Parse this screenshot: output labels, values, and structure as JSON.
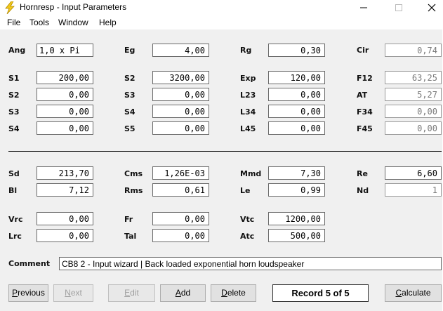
{
  "window": {
    "title": "Hornresp - Input Parameters"
  },
  "menu": [
    "File",
    "Tools",
    "Window",
    "Help"
  ],
  "icons": {
    "app": "lightning-bolt-icon",
    "minimize": "minimize-icon",
    "maximize": "maximize-icon",
    "close": "close-icon"
  },
  "fields": {
    "Ang": "1,0 x Pi",
    "Eg": "4,00",
    "Rg": "0,30",
    "Cir": "0,74",
    "S1": "200,00",
    "S2": "3200,00",
    "Exp": "120,00",
    "F12": "63,25",
    "S2b": "0,00",
    "S3": "0,00",
    "L23": "0,00",
    "AT": "5,27",
    "S3b": "0,00",
    "S4": "0,00",
    "L34": "0,00",
    "F34": "0,00",
    "S4b": "0,00",
    "S5": "0,00",
    "L45": "0,00",
    "F45": "0,00",
    "Sd": "213,70",
    "Cms": "1,26E-03",
    "Mmd": "7,30",
    "Re": "6,60",
    "Bl": "7,12",
    "Rms": "0,61",
    "Le": "0,99",
    "Nd": "1",
    "Vrc": "0,00",
    "Fr": "0,00",
    "Vtc": "1200,00",
    "Lrc": "0,00",
    "Tal": "0,00",
    "Atc": "500,00"
  },
  "labels": {
    "Ang": "Ang",
    "Eg": "Eg",
    "Rg": "Rg",
    "Cir": "Cir",
    "S1": "S1",
    "S2": "S2",
    "Exp": "Exp",
    "F12": "F12",
    "S2b": "S2",
    "S3": "S3",
    "L23": "L23",
    "AT": "AT",
    "S3b": "S3",
    "S4": "S4",
    "L34": "L34",
    "F34": "F34",
    "S4b": "S4",
    "S5": "S5",
    "L45": "L45",
    "F45": "F45",
    "Sd": "Sd",
    "Cms": "Cms",
    "Mmd": "Mmd",
    "Re": "Re",
    "Bl": "Bl",
    "Rms": "Rms",
    "Le": "Le",
    "Nd": "Nd",
    "Vrc": "Vrc",
    "Fr": "Fr",
    "Vtc": "Vtc",
    "Lrc": "Lrc",
    "Tal": "Tal",
    "Atc": "Atc"
  },
  "comment": {
    "label": "Comment",
    "value": "CB8 2 - Input wizard | Back loaded exponential horn loudspeaker"
  },
  "buttons": {
    "previous_pre": "",
    "previous_u": "P",
    "previous_post": "revious",
    "next_pre": "",
    "next_u": "N",
    "next_post": "ext",
    "edit_pre": "",
    "edit_u": "E",
    "edit_post": "dit",
    "add_pre": "",
    "add_u": "A",
    "add_post": "dd",
    "delete_pre": "",
    "delete_u": "D",
    "delete_post": "elete",
    "calculate_pre": "",
    "calculate_u": "C",
    "calculate_post": "alculate"
  },
  "record": "Record 5 of 5"
}
